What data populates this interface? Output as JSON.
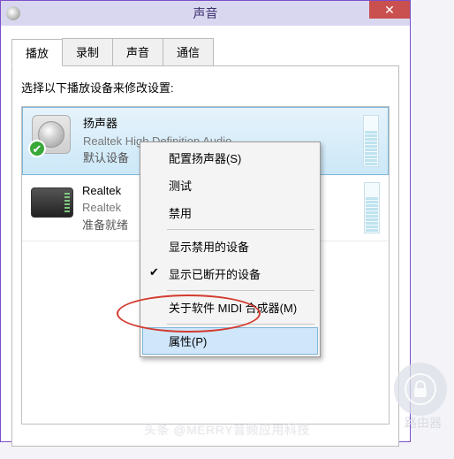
{
  "window": {
    "title": "声音",
    "close_glyph": "✕"
  },
  "tabs": {
    "playback": "播放",
    "recording": "录制",
    "sounds": "声音",
    "comm": "通信"
  },
  "instruction": "选择以下播放设备来修改设置:",
  "devices": [
    {
      "name": "扬声器",
      "sub": "Realtek High Definition Audio",
      "status": "默认设备"
    },
    {
      "name": "Realtek",
      "sub": "Realtek",
      "status": "准备就绪"
    }
  ],
  "context_menu": {
    "configure": "配置扬声器(S)",
    "test": "测试",
    "disable": "禁用",
    "show_disabled": "显示禁用的设备",
    "show_disconnected": "显示已断开的设备",
    "about_midi": "关于软件 MIDI 合成器(M)",
    "properties": "属性(P)",
    "check_glyph": "✔"
  },
  "overlay": {
    "footer": "头条 @MERRY音频应用科技",
    "router": "路由器"
  }
}
